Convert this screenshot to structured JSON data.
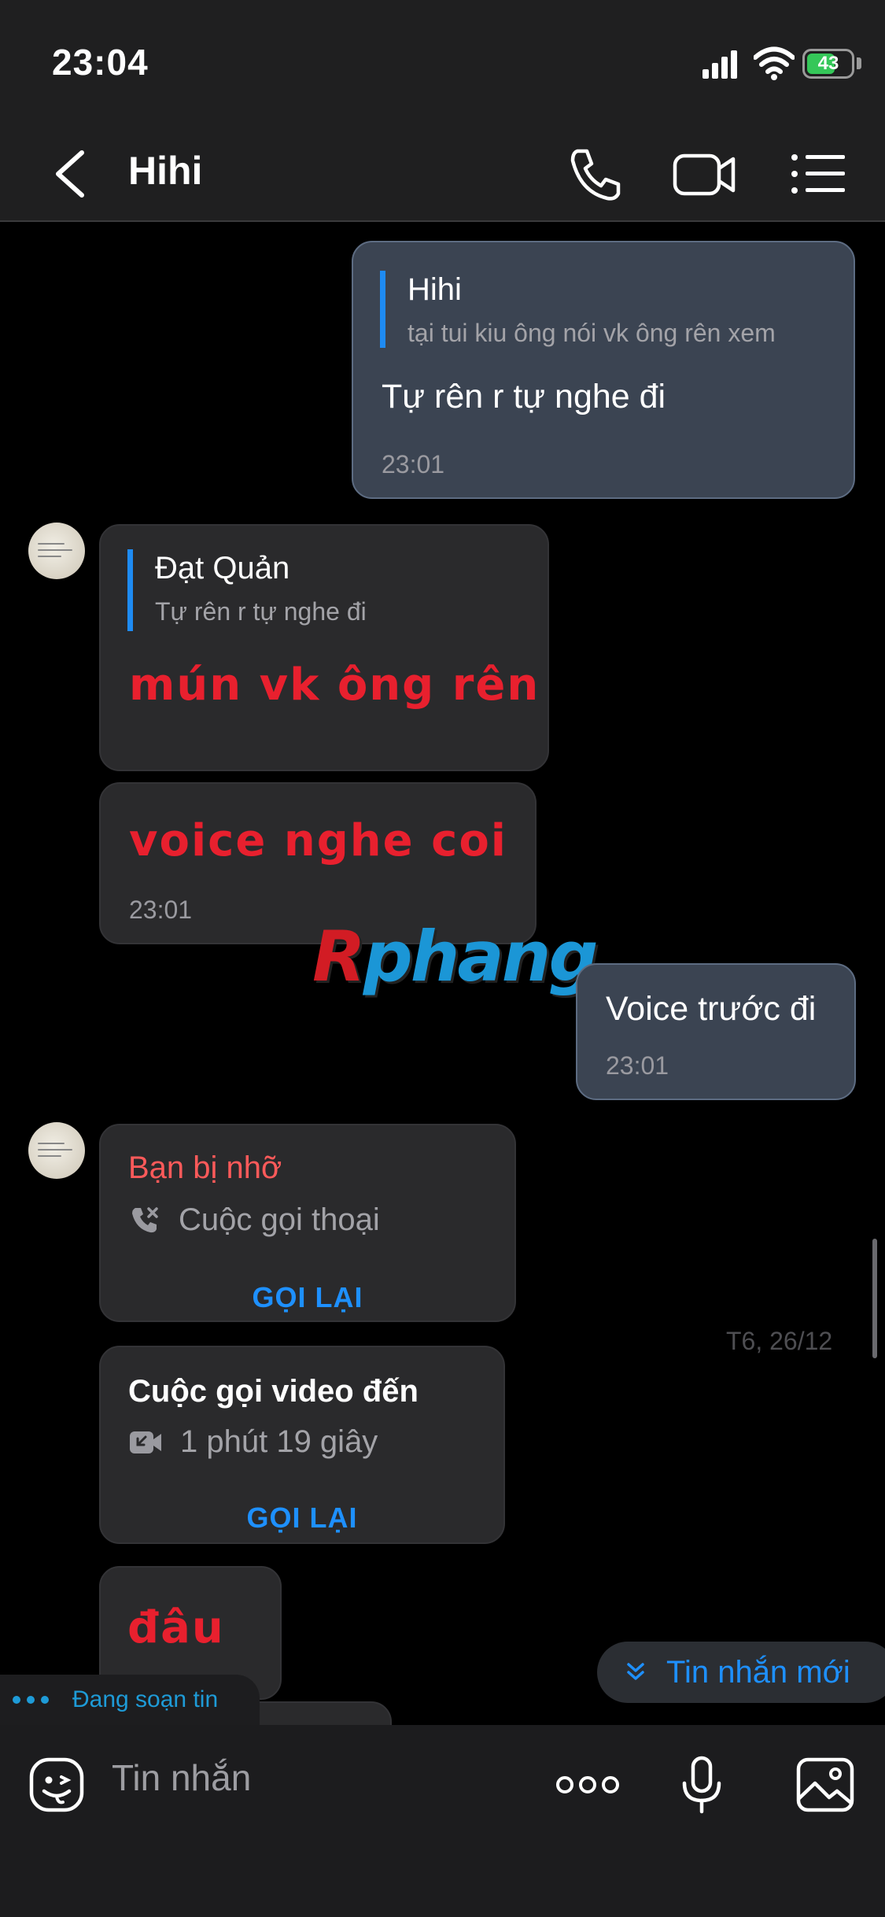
{
  "status_bar": {
    "time": "23:04",
    "battery": "43"
  },
  "header": {
    "title": "Hihi"
  },
  "messages": {
    "m1": {
      "quote_name": "Hihi",
      "quote_text": "tại tui kiu ông nói vk ông rên xem",
      "text": "Tự rên r tự nghe đi",
      "time": "23:01"
    },
    "m2": {
      "quote_name": "Đạt Quản",
      "quote_text": "Tự rên r tự nghe đi",
      "text": "mún vk ông rên"
    },
    "m3": {
      "text": "voice nghe coi",
      "time": "23:01"
    },
    "m4": {
      "text": "Voice trước đi",
      "time": "23:01"
    },
    "m5": {
      "title": "Bạn bị nhỡ",
      "call_type": "Cuộc gọi thoại",
      "action": "GỌI LẠI"
    },
    "date_separator": "T6, 26/12",
    "m6": {
      "title": "Cuộc gọi video đến",
      "duration": "1 phút 19 giây",
      "action": "GỌI LẠI"
    },
    "m7": {
      "text": "đâu"
    }
  },
  "watermark": {
    "part1": "R",
    "part2": "phang"
  },
  "new_messages_button": "Tin nhắn mới",
  "typing_indicator": "Đang soạn tin",
  "composer": {
    "placeholder": "Tin nhắn"
  },
  "icons": {
    "back": "chevron-left-icon",
    "call": "phone-icon",
    "video": "video-camera-icon",
    "menu": "list-icon",
    "missed_call": "missed-call-icon",
    "incoming_video": "incoming-video-icon",
    "emoji": "sticker-icon",
    "more": "more-dots-icon",
    "mic": "microphone-icon",
    "gallery": "image-icon"
  },
  "colors": {
    "accent": "#1e90ff",
    "outgoing_bubble": "#3b4452",
    "incoming_bubble": "#2a2a2c",
    "missed_red": "#ff5a5a",
    "highlight_red": "#e8202e"
  }
}
